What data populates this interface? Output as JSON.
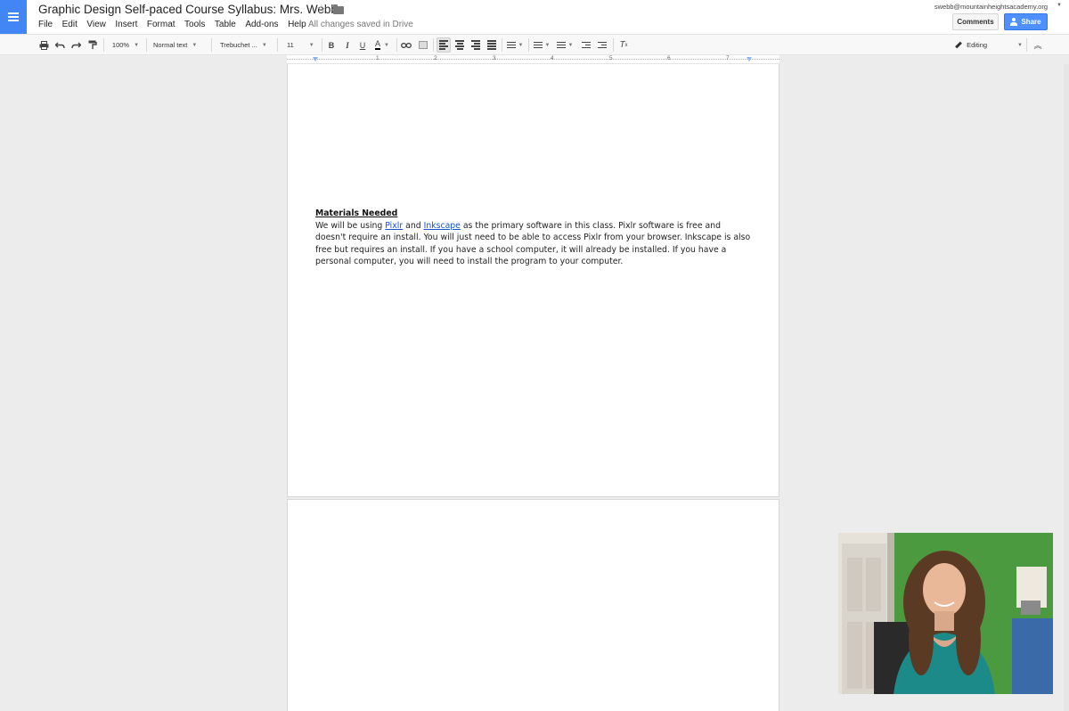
{
  "header": {
    "title": "Graphic Design Self-paced Course Syllabus: Mrs. Webb",
    "menu": [
      "File",
      "Edit",
      "View",
      "Insert",
      "Format",
      "Tools",
      "Table",
      "Add-ons",
      "Help"
    ],
    "save_status": "All changes saved in Drive",
    "account": "swebb@mountainheightsacademy.org",
    "comments_label": "Comments",
    "share_label": "Share"
  },
  "toolbar": {
    "zoom": "100%",
    "style": "Normal text",
    "font": "Trebuchet ...",
    "size": "11",
    "mode": "Editing"
  },
  "ruler": {
    "labels": [
      "1",
      "2",
      "3",
      "4",
      "5",
      "6",
      "7"
    ]
  },
  "document": {
    "heading": "Materials Needed",
    "para_1": "We will be using ",
    "link_1": "Pixlr",
    "para_2": " and ",
    "link_2": "Inkscape",
    "para_3": " as the primary software in this class. Pixlr software is free and doesn't require an install. You will just need to be able to access Pixlr from your browser. Inkscape is also free but requires an install.  If you have a school computer, it will already be installed.  If you have a personal computer, you will need to install the program to your computer."
  },
  "colors": {
    "accent": "#4285f4",
    "share_button": "#4d90fe",
    "link": "#1155cc",
    "canvas": "#ececec"
  },
  "icons": [
    "docs-menu-icon",
    "star-icon",
    "folder-icon",
    "print-icon",
    "undo-icon",
    "redo-icon",
    "paint-format-icon",
    "bold-icon",
    "italic-icon",
    "underline-icon",
    "text-color-icon",
    "link-icon",
    "comment-icon",
    "align-left-icon",
    "align-center-icon",
    "align-right-icon",
    "align-justify-icon",
    "line-spacing-icon",
    "numbered-list-icon",
    "bulleted-list-icon",
    "decrease-indent-icon",
    "increase-indent-icon",
    "clear-formatting-icon",
    "pencil-icon",
    "collapse-icon"
  ]
}
